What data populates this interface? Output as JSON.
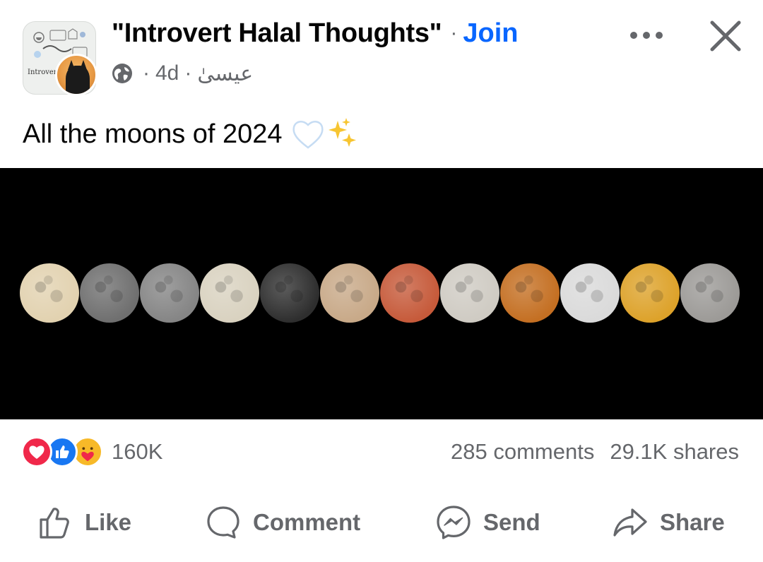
{
  "post": {
    "group_name": "\"Introvert Halal Thoughts\"",
    "join_label": "Join",
    "separator": "·",
    "time": "4d",
    "author": "عيسىٰ",
    "group_avatar_text": "Introvert",
    "caption_text": "All the moons of 2024",
    "caption_emoji": [
      "white-heart-emoji",
      "sparkles-emoji"
    ]
  },
  "image": {
    "background": "#000000",
    "moon_colors": [
      "#e2d2b0",
      "#6f6f6f",
      "#858585",
      "#d9d2c0",
      "#2e2e2e",
      "#c8a988",
      "#c65a3a",
      "#cfcbc3",
      "#c46f22",
      "#dadada",
      "#dda22a",
      "#9c9a97"
    ]
  },
  "stats": {
    "reaction_icons": [
      "love-reaction-icon",
      "like-reaction-icon",
      "care-reaction-icon"
    ],
    "reaction_count": "160K",
    "comments": "285 comments",
    "shares": "29.1K shares"
  },
  "actions": {
    "like": "Like",
    "comment": "Comment",
    "send": "Send",
    "share": "Share"
  },
  "colors": {
    "join_blue": "#0866ff",
    "secondary_text": "#65676b",
    "love_red": "#f0284a",
    "like_blue": "#1877f2",
    "care_yellow": "#f7b928"
  }
}
